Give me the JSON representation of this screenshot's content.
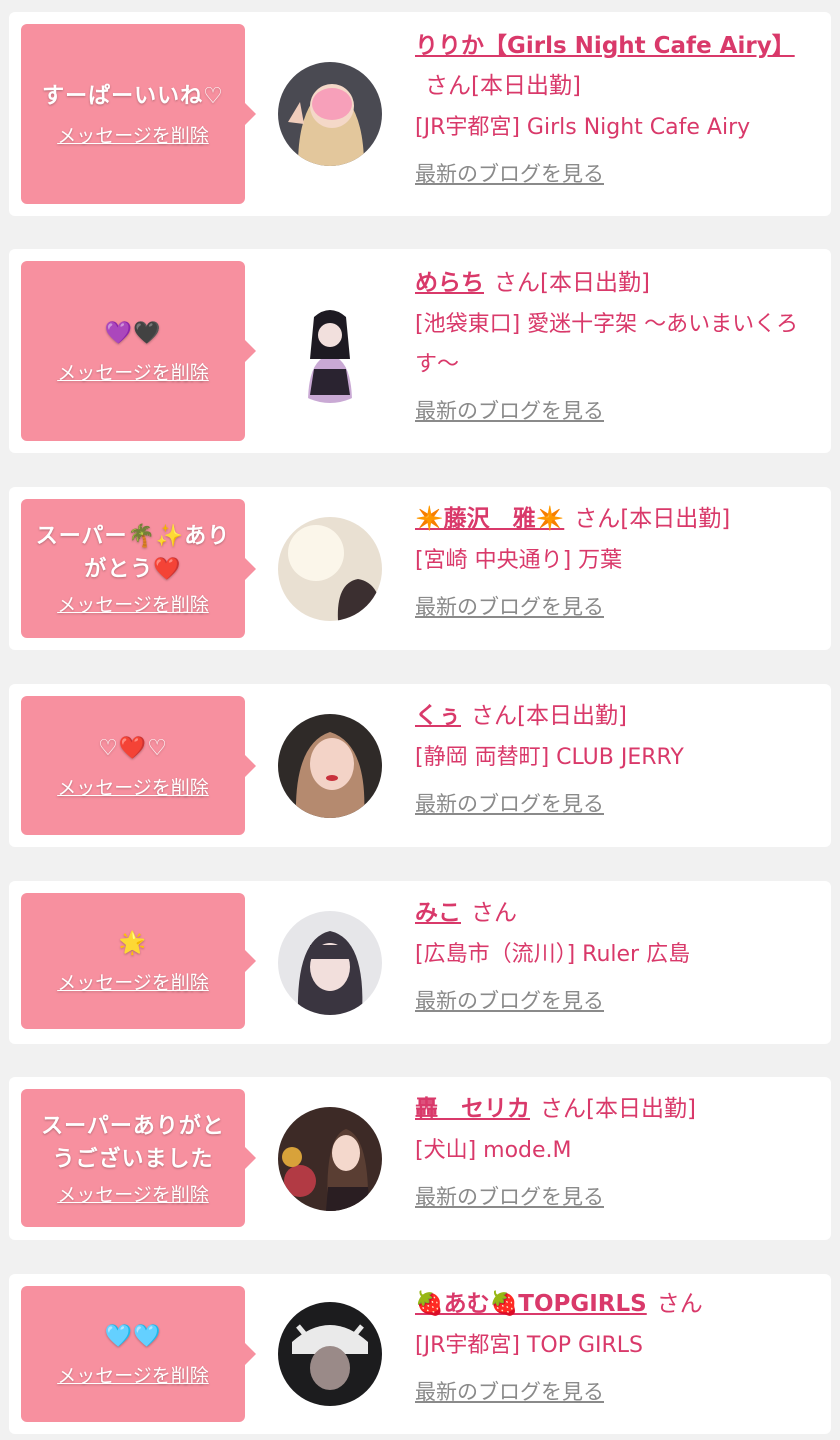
{
  "delete_label": "メッセージを削除",
  "san_label": "さん",
  "shift_label": "[本日出勤]",
  "blog_label": "最新のブログを見る",
  "cards": [
    {
      "message": "すーぱーいいね♡",
      "name": "りりか【Girls Night Cafe Airy】",
      "shift": "[本日出勤]",
      "shop": "[JR宇都宮] Girls Night Cafe Airy"
    },
    {
      "message": "💜🖤",
      "name": "めらち",
      "shift": "[本日出勤]",
      "shop": "[池袋東口] 愛迷十字架 〜あいまいくろす〜"
    },
    {
      "message": "スーパー🌴✨ありがとう❤️",
      "name": "✴️藤沢　雅✴️",
      "shift": "[本日出勤]",
      "shop": "[宮崎 中央通り] 万葉"
    },
    {
      "message": "♡❤️♡",
      "name": "くぅ",
      "shift": "[本日出勤]",
      "shop": "[静岡 両替町] CLUB JERRY"
    },
    {
      "message": "🌟",
      "name": "みこ",
      "shift": "",
      "shop": "[広島市（流川）] Ruler 広島"
    },
    {
      "message": "スーパーありがとうございました",
      "name": "轟　セリカ",
      "shift": "[本日出勤]",
      "shop": "[犬山] mode.M"
    },
    {
      "message": "🩵🩵",
      "name": "🍓あむ🍓TOPGIRLS",
      "shift": "",
      "shop": "[JR宇都宮] TOP GIRLS"
    }
  ],
  "colors": {
    "accent": "#d9396a",
    "bubble": "#f7909f",
    "background": "#f1f1f1",
    "link_gray": "#8a8a8a"
  }
}
